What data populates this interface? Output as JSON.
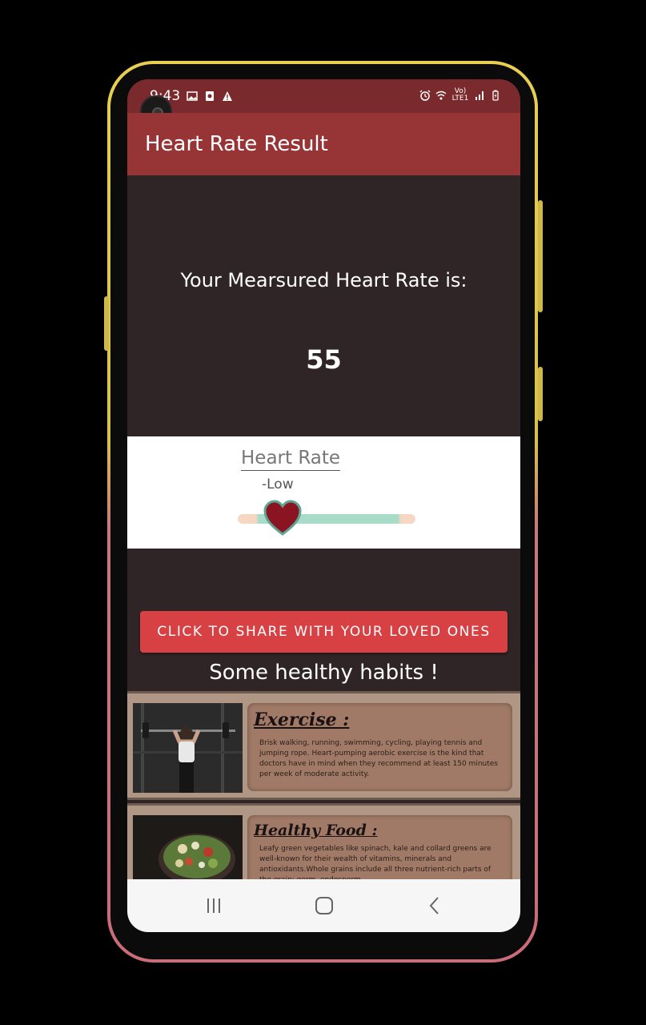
{
  "status_bar": {
    "time": "9:43",
    "network": "Vo) LTE1"
  },
  "app_bar": {
    "title": "Heart Rate Result"
  },
  "result": {
    "label": "Your Mearsured Heart Rate is:",
    "value": "55"
  },
  "gauge": {
    "title": "Heart Rate",
    "level": "-Low",
    "position_fraction": 0.25
  },
  "share_button": {
    "label": "CLICK TO SHARE WITH YOUR LOVED ONES"
  },
  "habits": {
    "heading": "Some healthy habits !",
    "items": [
      {
        "title": "Exercise :",
        "text": "Brisk walking, running, swimming, cycling, playing tennis and jumping rope. Heart-pumping aerobic exercise is the kind that doctors have in mind when they recommend at least 150 minutes per week of moderate activity."
      },
      {
        "title": "Healthy Food :",
        "text": "Leafy green vegetables like spinach, kale and collard greens are well-known for their wealth of vitamins, minerals and antioxidants.Whole grains include all three nutrient-rich parts of the grain: germ, endosperm"
      }
    ]
  },
  "colors": {
    "app_bar": "#973436",
    "status_bar": "#7a2a2d",
    "background": "#302526",
    "share_button": "#d84144",
    "heart": "#8b1422"
  },
  "icons": {
    "status_left": [
      "image-icon",
      "notification-icon",
      "warning-icon"
    ],
    "status_right": [
      "alarm-icon",
      "wifi-icon",
      "signal-icon",
      "battery-icon"
    ],
    "nav": [
      "recent-apps-icon",
      "home-icon",
      "back-icon"
    ]
  }
}
